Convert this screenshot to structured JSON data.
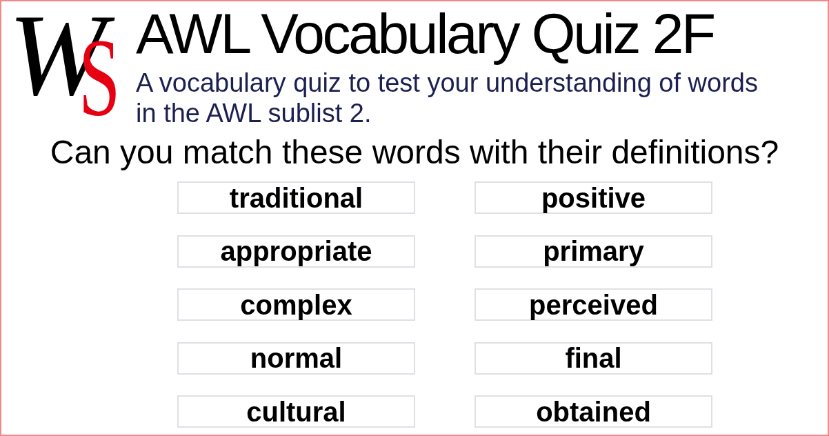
{
  "logo": {
    "letters": [
      "W",
      "S"
    ]
  },
  "title": "AWL Vocabulary Quiz 2F",
  "subtitle": "A vocabulary quiz to test your understanding of words in the AWL sublist 2.",
  "question": "Can you match these words with their definitions?",
  "words": [
    "traditional",
    "positive",
    "appropriate",
    "primary",
    "complex",
    "perceived",
    "normal",
    "final",
    "cultural",
    "obtained"
  ]
}
